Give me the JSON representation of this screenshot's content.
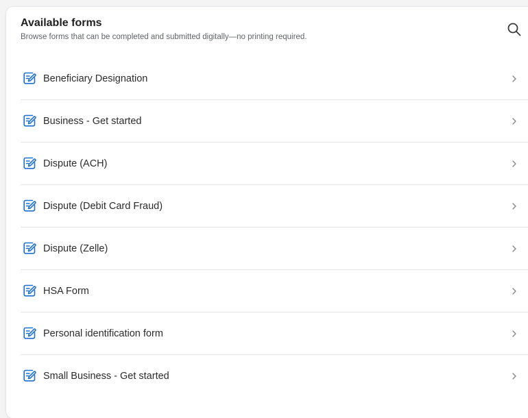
{
  "header": {
    "title": "Available forms",
    "subtitle": "Browse forms that can be completed and submitted digitally—no printing required."
  },
  "icons": {
    "search": "search-icon",
    "form": "edit-form-icon",
    "chevron": "chevron-right-icon"
  },
  "colors": {
    "accent": "#1a6fd4",
    "chevron": "#8a8a8a",
    "divider": "#e3e3e3"
  },
  "forms": [
    {
      "label": "Beneficiary Designation"
    },
    {
      "label": "Business - Get started"
    },
    {
      "label": "Dispute (ACH)"
    },
    {
      "label": "Dispute (Debit Card Fraud)"
    },
    {
      "label": "Dispute (Zelle)"
    },
    {
      "label": "HSA Form"
    },
    {
      "label": "Personal identification form"
    },
    {
      "label": "Small Business - Get started"
    }
  ]
}
